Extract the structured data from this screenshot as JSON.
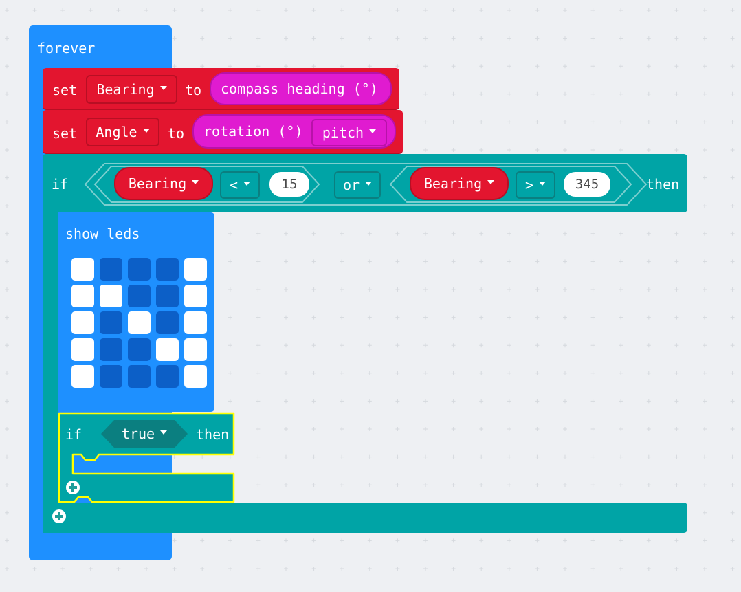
{
  "colors": {
    "workspace_bg": "#eef0f3",
    "grid_cross": "#d5d9de",
    "loops_blue": "#1e90ff",
    "variables_red": "#e3152f",
    "input_magenta": "#e01bd0",
    "logic_teal": "#00a4a6",
    "logic_dark": "#0b7f80",
    "led_off": "#0c5fc7",
    "led_on": "#ffffff",
    "selection_yellow": "#ffff00"
  },
  "blocks": {
    "forever": {
      "label": "forever"
    },
    "set_bearing": {
      "set_label": "set",
      "variable": "Bearing",
      "to_label": "to",
      "value": "compass heading (°)"
    },
    "set_angle": {
      "set_label": "set",
      "variable": "Angle",
      "to_label": "to",
      "value_label": "rotation (°)",
      "value_option": "pitch"
    },
    "if_outer": {
      "if_label": "if",
      "left": {
        "variable": "Bearing",
        "operator": "<",
        "number": "15"
      },
      "logic_op": "or",
      "right": {
        "variable": "Bearing",
        "operator": ">",
        "number": "345"
      },
      "then_label": "then"
    },
    "show_leds": {
      "label": "show leds",
      "grid": [
        [
          1,
          0,
          0,
          0,
          1
        ],
        [
          1,
          1,
          0,
          0,
          1
        ],
        [
          1,
          0,
          1,
          0,
          1
        ],
        [
          1,
          0,
          0,
          1,
          1
        ],
        [
          1,
          0,
          0,
          0,
          1
        ]
      ]
    },
    "if_inner": {
      "if_label": "if",
      "condition": "true",
      "then_label": "then"
    }
  },
  "icons": {
    "add_else_inner": "plus-circle-icon",
    "add_else_outer": "plus-circle-icon",
    "dropdown": "caret-down-icon"
  }
}
